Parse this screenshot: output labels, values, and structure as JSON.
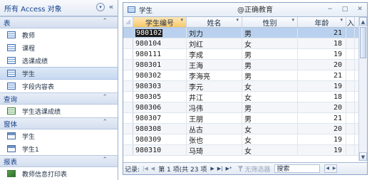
{
  "nav": {
    "header": "所有 Access 对象",
    "header_button_icon": "chevron-down-icon",
    "collapse_icon": "double-chevron-left-icon",
    "groups": [
      {
        "title": "表",
        "items": [
          {
            "label": "教师",
            "icon": "table-icon"
          },
          {
            "label": "课程",
            "icon": "table-icon"
          },
          {
            "label": "选课成绩",
            "icon": "table-icon"
          },
          {
            "label": "学生",
            "icon": "table-icon",
            "selected": true
          },
          {
            "label": "字段内容表",
            "icon": "table-icon"
          }
        ]
      },
      {
        "title": "查询",
        "items": [
          {
            "label": "学生选课成绩",
            "icon": "query-icon"
          }
        ]
      },
      {
        "title": "窗体",
        "items": [
          {
            "label": "学生",
            "icon": "form-icon"
          },
          {
            "label": "学生1",
            "icon": "form-icon"
          }
        ]
      },
      {
        "title": "报表",
        "items": [
          {
            "label": "教师信息打印表",
            "icon": "report-icon"
          }
        ]
      }
    ],
    "group_chevron": "⌃"
  },
  "doc": {
    "tab_title": "学生",
    "watermark": "@正确教育",
    "window_buttons": [
      "−",
      "□",
      "✕"
    ]
  },
  "datasheet": {
    "columns": [
      "学生编号",
      "姓名",
      "性别",
      "年龄",
      "入"
    ],
    "dropdown_glyph": "▾",
    "rows": [
      {
        "id": "980102",
        "name": "刘力",
        "sex": "男",
        "age": "21"
      },
      {
        "id": "980104",
        "name": "刘红",
        "sex": "女",
        "age": "18"
      },
      {
        "id": "980111",
        "name": "李成",
        "sex": "男",
        "age": "19"
      },
      {
        "id": "980301",
        "name": "王海",
        "sex": "男",
        "age": "20"
      },
      {
        "id": "980302",
        "name": "李海亮",
        "sex": "男",
        "age": "21"
      },
      {
        "id": "980303",
        "name": "李元",
        "sex": "女",
        "age": "19"
      },
      {
        "id": "980305",
        "name": "井江",
        "sex": "女",
        "age": "18"
      },
      {
        "id": "980306",
        "name": "冯伟",
        "sex": "男",
        "age": "20"
      },
      {
        "id": "980307",
        "name": "王朋",
        "sex": "男",
        "age": "21"
      },
      {
        "id": "980308",
        "name": "丛古",
        "sex": "女",
        "age": "20"
      },
      {
        "id": "980309",
        "name": "张也",
        "sex": "女",
        "age": "19"
      },
      {
        "id": "980310",
        "name": "马琦",
        "sex": "女",
        "age": "19"
      }
    ]
  },
  "record_nav": {
    "label": "记录:",
    "first": "|◀",
    "prev": "◀",
    "position": "第 1 项(共 23 项",
    "next": "▶",
    "last": "▶|",
    "new": "▶*",
    "filter_label": "无筛选器",
    "search_placeholder": "搜索"
  },
  "colors": {
    "accent": "#15428b",
    "selected_row": "#b9d1ee",
    "active_header": "#f7c96b"
  }
}
